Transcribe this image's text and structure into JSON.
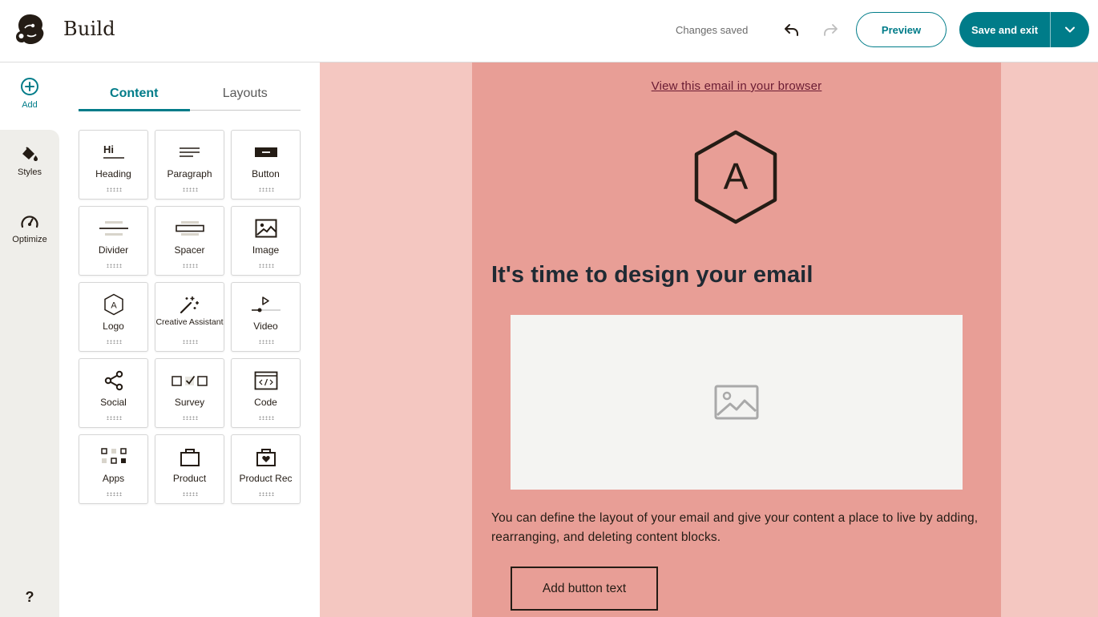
{
  "header": {
    "title": "Build",
    "status": "Changes saved",
    "preview_label": "Preview",
    "save_label": "Save and exit"
  },
  "rail": {
    "add_label": "Add",
    "styles_label": "Styles",
    "optimize_label": "Optimize",
    "help_label": "?"
  },
  "panel": {
    "tabs": [
      {
        "label": "Content",
        "active": true
      },
      {
        "label": "Layouts",
        "active": false
      }
    ],
    "blocks": [
      {
        "label": "Heading",
        "icon": "heading-icon"
      },
      {
        "label": "Paragraph",
        "icon": "paragraph-icon"
      },
      {
        "label": "Button",
        "icon": "button-icon"
      },
      {
        "label": "Divider",
        "icon": "divider-icon"
      },
      {
        "label": "Spacer",
        "icon": "spacer-icon"
      },
      {
        "label": "Image",
        "icon": "image-icon"
      },
      {
        "label": "Logo",
        "icon": "logo-icon"
      },
      {
        "label": "Creative Assistant",
        "icon": "magic-wand-icon"
      },
      {
        "label": "Video",
        "icon": "video-icon"
      },
      {
        "label": "Social",
        "icon": "share-icon"
      },
      {
        "label": "Survey",
        "icon": "survey-icon"
      },
      {
        "label": "Code",
        "icon": "code-icon"
      },
      {
        "label": "Apps",
        "icon": "apps-icon"
      },
      {
        "label": "Product",
        "icon": "shopping-bag-icon"
      },
      {
        "label": "Product Rec",
        "icon": "heart-bag-icon"
      }
    ]
  },
  "email": {
    "view_link": "View this email in your browser",
    "logo_letter": "A",
    "headline": "It's time to design your email",
    "body": "You can define the layout of your email and give your content a place to live by adding, rearranging, and deleting content blocks.",
    "button_text": "Add button text"
  },
  "colors": {
    "accent": "#007c89",
    "canvas_bg": "#f4c7c1",
    "email_bg": "#e89e96",
    "text_dark": "#241c15"
  }
}
